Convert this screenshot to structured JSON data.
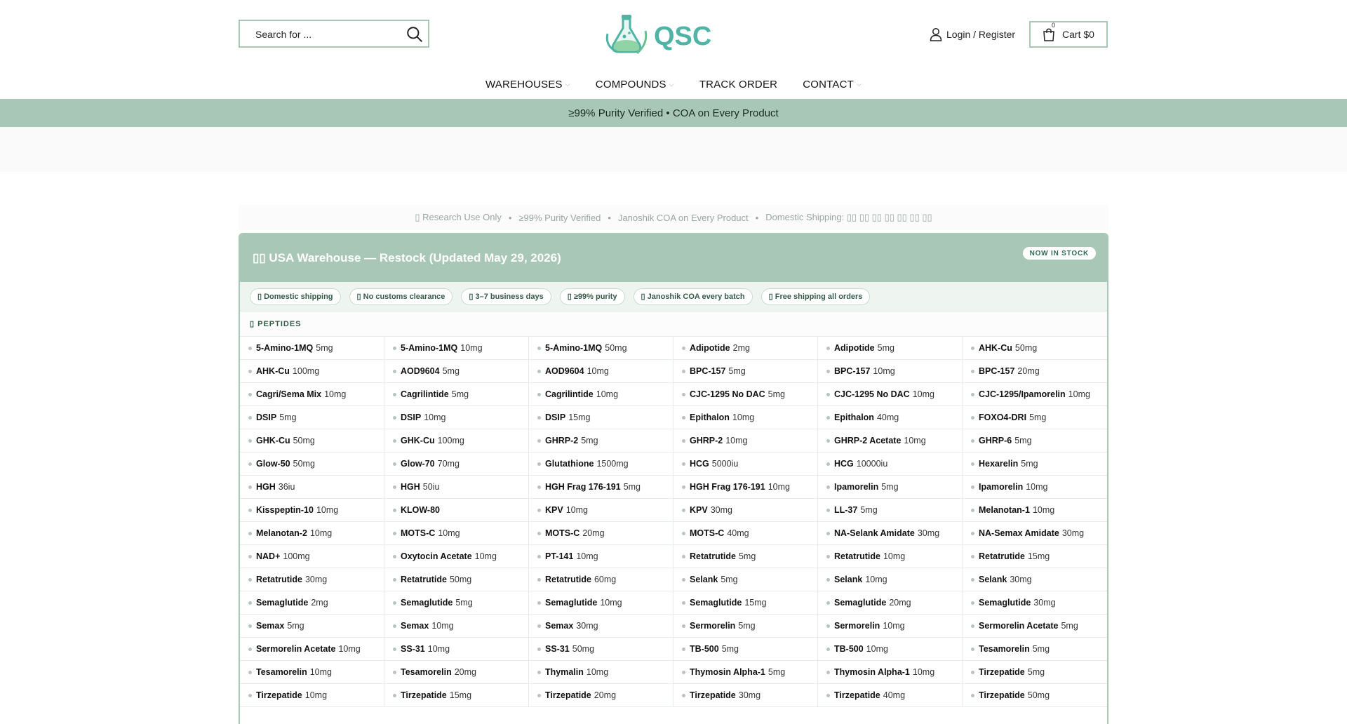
{
  "header": {
    "search_placeholder": "Search for ...",
    "logo_text": "QSC",
    "account_label": "Login / Register",
    "cart_label": "Cart $0",
    "cart_count": "0"
  },
  "nav": {
    "items": [
      {
        "label": "WAREHOUSES",
        "chev": "⌵"
      },
      {
        "label": "COMPOUNDS",
        "chev": "⌵"
      },
      {
        "label": "TRACK ORDER",
        "chev": ""
      },
      {
        "label": "CONTACT",
        "chev": "⌵"
      }
    ]
  },
  "banner": {
    "text": "≥99% Purity Verified • COA on Every Product"
  },
  "notice": {
    "items": [
      "▯ Research Use Only",
      "≥99% Purity Verified",
      "Janoshik COA on Every Product",
      "Domestic Shipping: ▯▯ ▯▯ ▯▯ ▯▯ ▯▯ ▯▯ ▯▯"
    ],
    "separator": "•"
  },
  "warehouse": {
    "title": "▯▯ USA Warehouse — Restock (Updated May 29, 2026)",
    "badge": "NOW IN STOCK",
    "features": [
      "▯ Domestic shipping",
      "▯ No customs clearance",
      "▯ 3–7 business days",
      "▯ ≥99% purity",
      "▯ Janoshik COA every batch",
      "▯ Free shipping all orders"
    ],
    "section_label": "▯ PEPTIDES",
    "products": [
      {
        "name": "5-Amino-1MQ",
        "dose": "5mg"
      },
      {
        "name": "5-Amino-1MQ",
        "dose": "10mg"
      },
      {
        "name": "5-Amino-1MQ",
        "dose": "50mg"
      },
      {
        "name": "Adipotide",
        "dose": "2mg"
      },
      {
        "name": "Adipotide",
        "dose": "5mg"
      },
      {
        "name": "AHK-Cu",
        "dose": "50mg"
      },
      {
        "name": "AHK-Cu",
        "dose": "100mg"
      },
      {
        "name": "AOD9604",
        "dose": "5mg"
      },
      {
        "name": "AOD9604",
        "dose": "10mg"
      },
      {
        "name": "BPC-157",
        "dose": "5mg"
      },
      {
        "name": "BPC-157",
        "dose": "10mg"
      },
      {
        "name": "BPC-157",
        "dose": "20mg"
      },
      {
        "name": "Cagri/Sema Mix",
        "dose": "10mg"
      },
      {
        "name": "Cagrilintide",
        "dose": "5mg"
      },
      {
        "name": "Cagrilintide",
        "dose": "10mg"
      },
      {
        "name": "CJC-1295 No DAC",
        "dose": "5mg"
      },
      {
        "name": "CJC-1295 No DAC",
        "dose": "10mg"
      },
      {
        "name": "CJC-1295/Ipamorelin",
        "dose": "10mg"
      },
      {
        "name": "DSIP",
        "dose": "5mg"
      },
      {
        "name": "DSIP",
        "dose": "10mg"
      },
      {
        "name": "DSIP",
        "dose": "15mg"
      },
      {
        "name": "Epithalon",
        "dose": "10mg"
      },
      {
        "name": "Epithalon",
        "dose": "40mg"
      },
      {
        "name": "FOXO4-DRI",
        "dose": "5mg"
      },
      {
        "name": "GHK-Cu",
        "dose": "50mg"
      },
      {
        "name": "GHK-Cu",
        "dose": "100mg"
      },
      {
        "name": "GHRP-2",
        "dose": "5mg"
      },
      {
        "name": "GHRP-2",
        "dose": "10mg"
      },
      {
        "name": "GHRP-2 Acetate",
        "dose": "10mg"
      },
      {
        "name": "GHRP-6",
        "dose": "5mg"
      },
      {
        "name": "Glow-50",
        "dose": "50mg"
      },
      {
        "name": "Glow-70",
        "dose": "70mg"
      },
      {
        "name": "Glutathione",
        "dose": "1500mg"
      },
      {
        "name": "HCG",
        "dose": "5000iu"
      },
      {
        "name": "HCG",
        "dose": "10000iu"
      },
      {
        "name": "Hexarelin",
        "dose": "5mg"
      },
      {
        "name": "HGH",
        "dose": "36iu"
      },
      {
        "name": "HGH",
        "dose": "50iu"
      },
      {
        "name": "HGH Frag 176-191",
        "dose": "5mg"
      },
      {
        "name": "HGH Frag 176-191",
        "dose": "10mg"
      },
      {
        "name": "Ipamorelin",
        "dose": "5mg"
      },
      {
        "name": "Ipamorelin",
        "dose": "10mg"
      },
      {
        "name": "Kisspeptin-10",
        "dose": "10mg"
      },
      {
        "name": "KLOW-80",
        "dose": ""
      },
      {
        "name": "KPV",
        "dose": "10mg"
      },
      {
        "name": "KPV",
        "dose": "30mg"
      },
      {
        "name": "LL-37",
        "dose": "5mg"
      },
      {
        "name": "Melanotan-1",
        "dose": "10mg"
      },
      {
        "name": "Melanotan-2",
        "dose": "10mg"
      },
      {
        "name": "MOTS-C",
        "dose": "10mg"
      },
      {
        "name": "MOTS-C",
        "dose": "20mg"
      },
      {
        "name": "MOTS-C",
        "dose": "40mg"
      },
      {
        "name": "NA-Selank Amidate",
        "dose": "30mg"
      },
      {
        "name": "NA-Semax Amidate",
        "dose": "30mg"
      },
      {
        "name": "NAD+",
        "dose": "100mg"
      },
      {
        "name": "Oxytocin Acetate",
        "dose": "10mg"
      },
      {
        "name": "PT-141",
        "dose": "10mg"
      },
      {
        "name": "Retatrutide",
        "dose": "5mg"
      },
      {
        "name": "Retatrutide",
        "dose": "10mg"
      },
      {
        "name": "Retatrutide",
        "dose": "15mg"
      },
      {
        "name": "Retatrutide",
        "dose": "30mg"
      },
      {
        "name": "Retatrutide",
        "dose": "50mg"
      },
      {
        "name": "Retatrutide",
        "dose": "60mg"
      },
      {
        "name": "Selank",
        "dose": "5mg"
      },
      {
        "name": "Selank",
        "dose": "10mg"
      },
      {
        "name": "Selank",
        "dose": "30mg"
      },
      {
        "name": "Semaglutide",
        "dose": "2mg"
      },
      {
        "name": "Semaglutide",
        "dose": "5mg"
      },
      {
        "name": "Semaglutide",
        "dose": "10mg"
      },
      {
        "name": "Semaglutide",
        "dose": "15mg"
      },
      {
        "name": "Semaglutide",
        "dose": "20mg"
      },
      {
        "name": "Semaglutide",
        "dose": "30mg"
      },
      {
        "name": "Semax",
        "dose": "5mg"
      },
      {
        "name": "Semax",
        "dose": "10mg"
      },
      {
        "name": "Semax",
        "dose": "30mg"
      },
      {
        "name": "Sermorelin",
        "dose": "5mg"
      },
      {
        "name": "Sermorelin",
        "dose": "10mg"
      },
      {
        "name": "Sermorelin Acetate",
        "dose": "5mg"
      },
      {
        "name": "Sermorelin Acetate",
        "dose": "10mg"
      },
      {
        "name": "SS-31",
        "dose": "10mg"
      },
      {
        "name": "SS-31",
        "dose": "50mg"
      },
      {
        "name": "TB-500",
        "dose": "5mg"
      },
      {
        "name": "TB-500",
        "dose": "10mg"
      },
      {
        "name": "Tesamorelin",
        "dose": "5mg"
      },
      {
        "name": "Tesamorelin",
        "dose": "10mg"
      },
      {
        "name": "Tesamorelin",
        "dose": "20mg"
      },
      {
        "name": "Thymalin",
        "dose": "10mg"
      },
      {
        "name": "Thymosin Alpha-1",
        "dose": "5mg"
      },
      {
        "name": "Thymosin Alpha-1",
        "dose": "10mg"
      },
      {
        "name": "Tirzepatide",
        "dose": "5mg"
      },
      {
        "name": "Tirzepatide",
        "dose": "10mg"
      },
      {
        "name": "Tirzepatide",
        "dose": "15mg"
      },
      {
        "name": "Tirzepatide",
        "dose": "20mg"
      },
      {
        "name": "Tirzepatide",
        "dose": "30mg"
      },
      {
        "name": "Tirzepatide",
        "dose": "40mg"
      },
      {
        "name": "Tirzepatide",
        "dose": "50mg"
      }
    ]
  },
  "colors": {
    "accent": "#a9c7b6",
    "accent_dark": "#355a48",
    "logo_teal": "#4fb3a5"
  }
}
